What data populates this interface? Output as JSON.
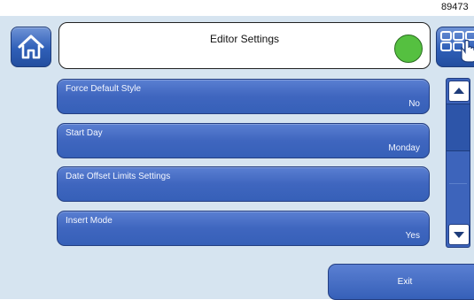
{
  "corner_id": "89473",
  "header": {
    "title": "Editor Settings",
    "status_color": "#55c040"
  },
  "settings": [
    {
      "label": "Force Default Style",
      "value": "No"
    },
    {
      "label": "Start Day",
      "value": "Monday"
    },
    {
      "label": "Date Offset Limits Settings",
      "value": ""
    },
    {
      "label": "Insert Mode",
      "value": "Yes"
    }
  ],
  "footer": {
    "exit_label": "Exit"
  },
  "colors": {
    "accent": "#3f66bf",
    "panel_bg": "#d6e4f0"
  },
  "icons": [
    "home-icon",
    "keypad-icon",
    "pointer-hand-icon",
    "arrow-up-icon",
    "arrow-down-icon"
  ]
}
